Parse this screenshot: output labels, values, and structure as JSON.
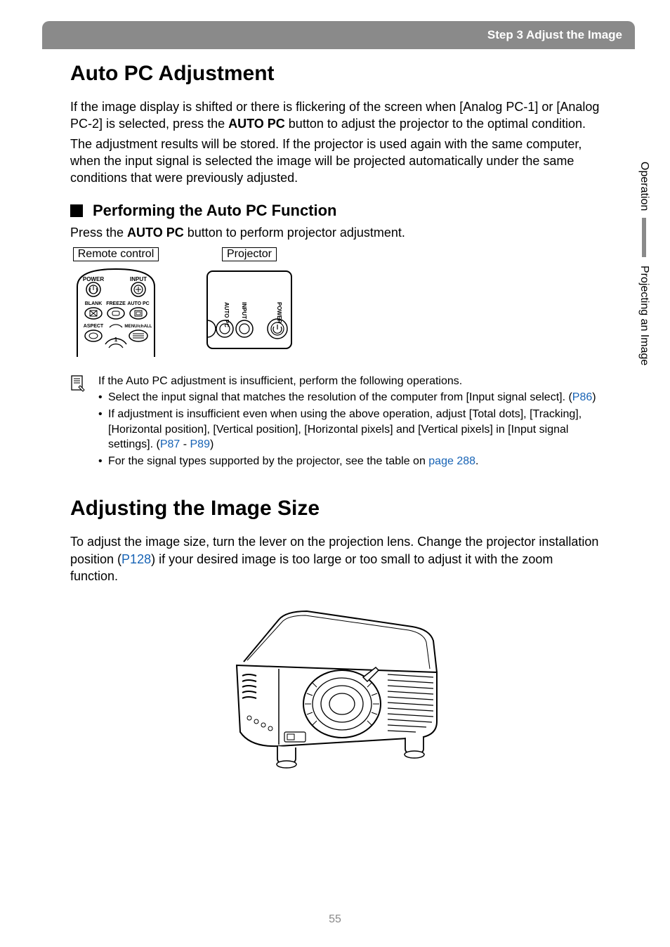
{
  "header": {
    "title": "Step 3 Adjust the Image"
  },
  "sideTabs": {
    "top": "Operation",
    "bottom": "Projecting an Image"
  },
  "section1": {
    "title": "Auto PC Adjustment",
    "para1a": "If the image display is shifted or there is flickering of the screen when [Analog PC-1] or [Analog PC-2] is selected, press the ",
    "para1b": "AUTO PC",
    "para1c": " button to adjust the projector to the optimal condition.",
    "para2": "The adjustment results will be stored. If the projector is used again with the same computer, when the input signal is selected the image will be projected automatically under the same conditions that were previously adjusted.",
    "subhead": "Performing the Auto PC Function",
    "subPara_a": "Press the ",
    "subPara_b": "AUTO PC",
    "subPara_c": " button to perform projector adjustment.",
    "fig1": "Remote control",
    "fig2": "Projector",
    "remote": {
      "power": "POWER",
      "input": "INPUT",
      "blank": "BLANK",
      "freeze": "FREEZE",
      "autopc": "AUTO PC",
      "aspect": "ASPECT",
      "menu": "MENU/chALL",
      "one": "1"
    },
    "proj": {
      "autopc": "AUTO PC",
      "input": "INPUT",
      "power": "POWER"
    },
    "note": {
      "intro": "If the Auto PC adjustment is insufficient, perform the following operations.",
      "b1a": "Select the input signal that matches the resolution of the computer from [Input signal select]. (",
      "b1link": "P86",
      "b1b": ")",
      "b2a": "If adjustment is insufficient even when using the above operation, adjust [Total dots], [Tracking], [Horizontal position], [Vertical position], [Horizontal pixels] and [Vertical pixels] in [Input signal settings]. (",
      "b2link1": "P87",
      "b2mid": " - ",
      "b2link2": "P89",
      "b2b": ")",
      "b3a": "For the signal types supported by the projector, see the table on ",
      "b3link": "page 288",
      "b3b": "."
    }
  },
  "section2": {
    "title": "Adjusting the Image Size",
    "para1a": "To adjust the image size, turn the lever on the projection lens. Change the projector installation position (",
    "para1link": "P128",
    "para1b": ") if your desired image is too large or too small to adjust it with the zoom function."
  },
  "pageNumber": "55"
}
